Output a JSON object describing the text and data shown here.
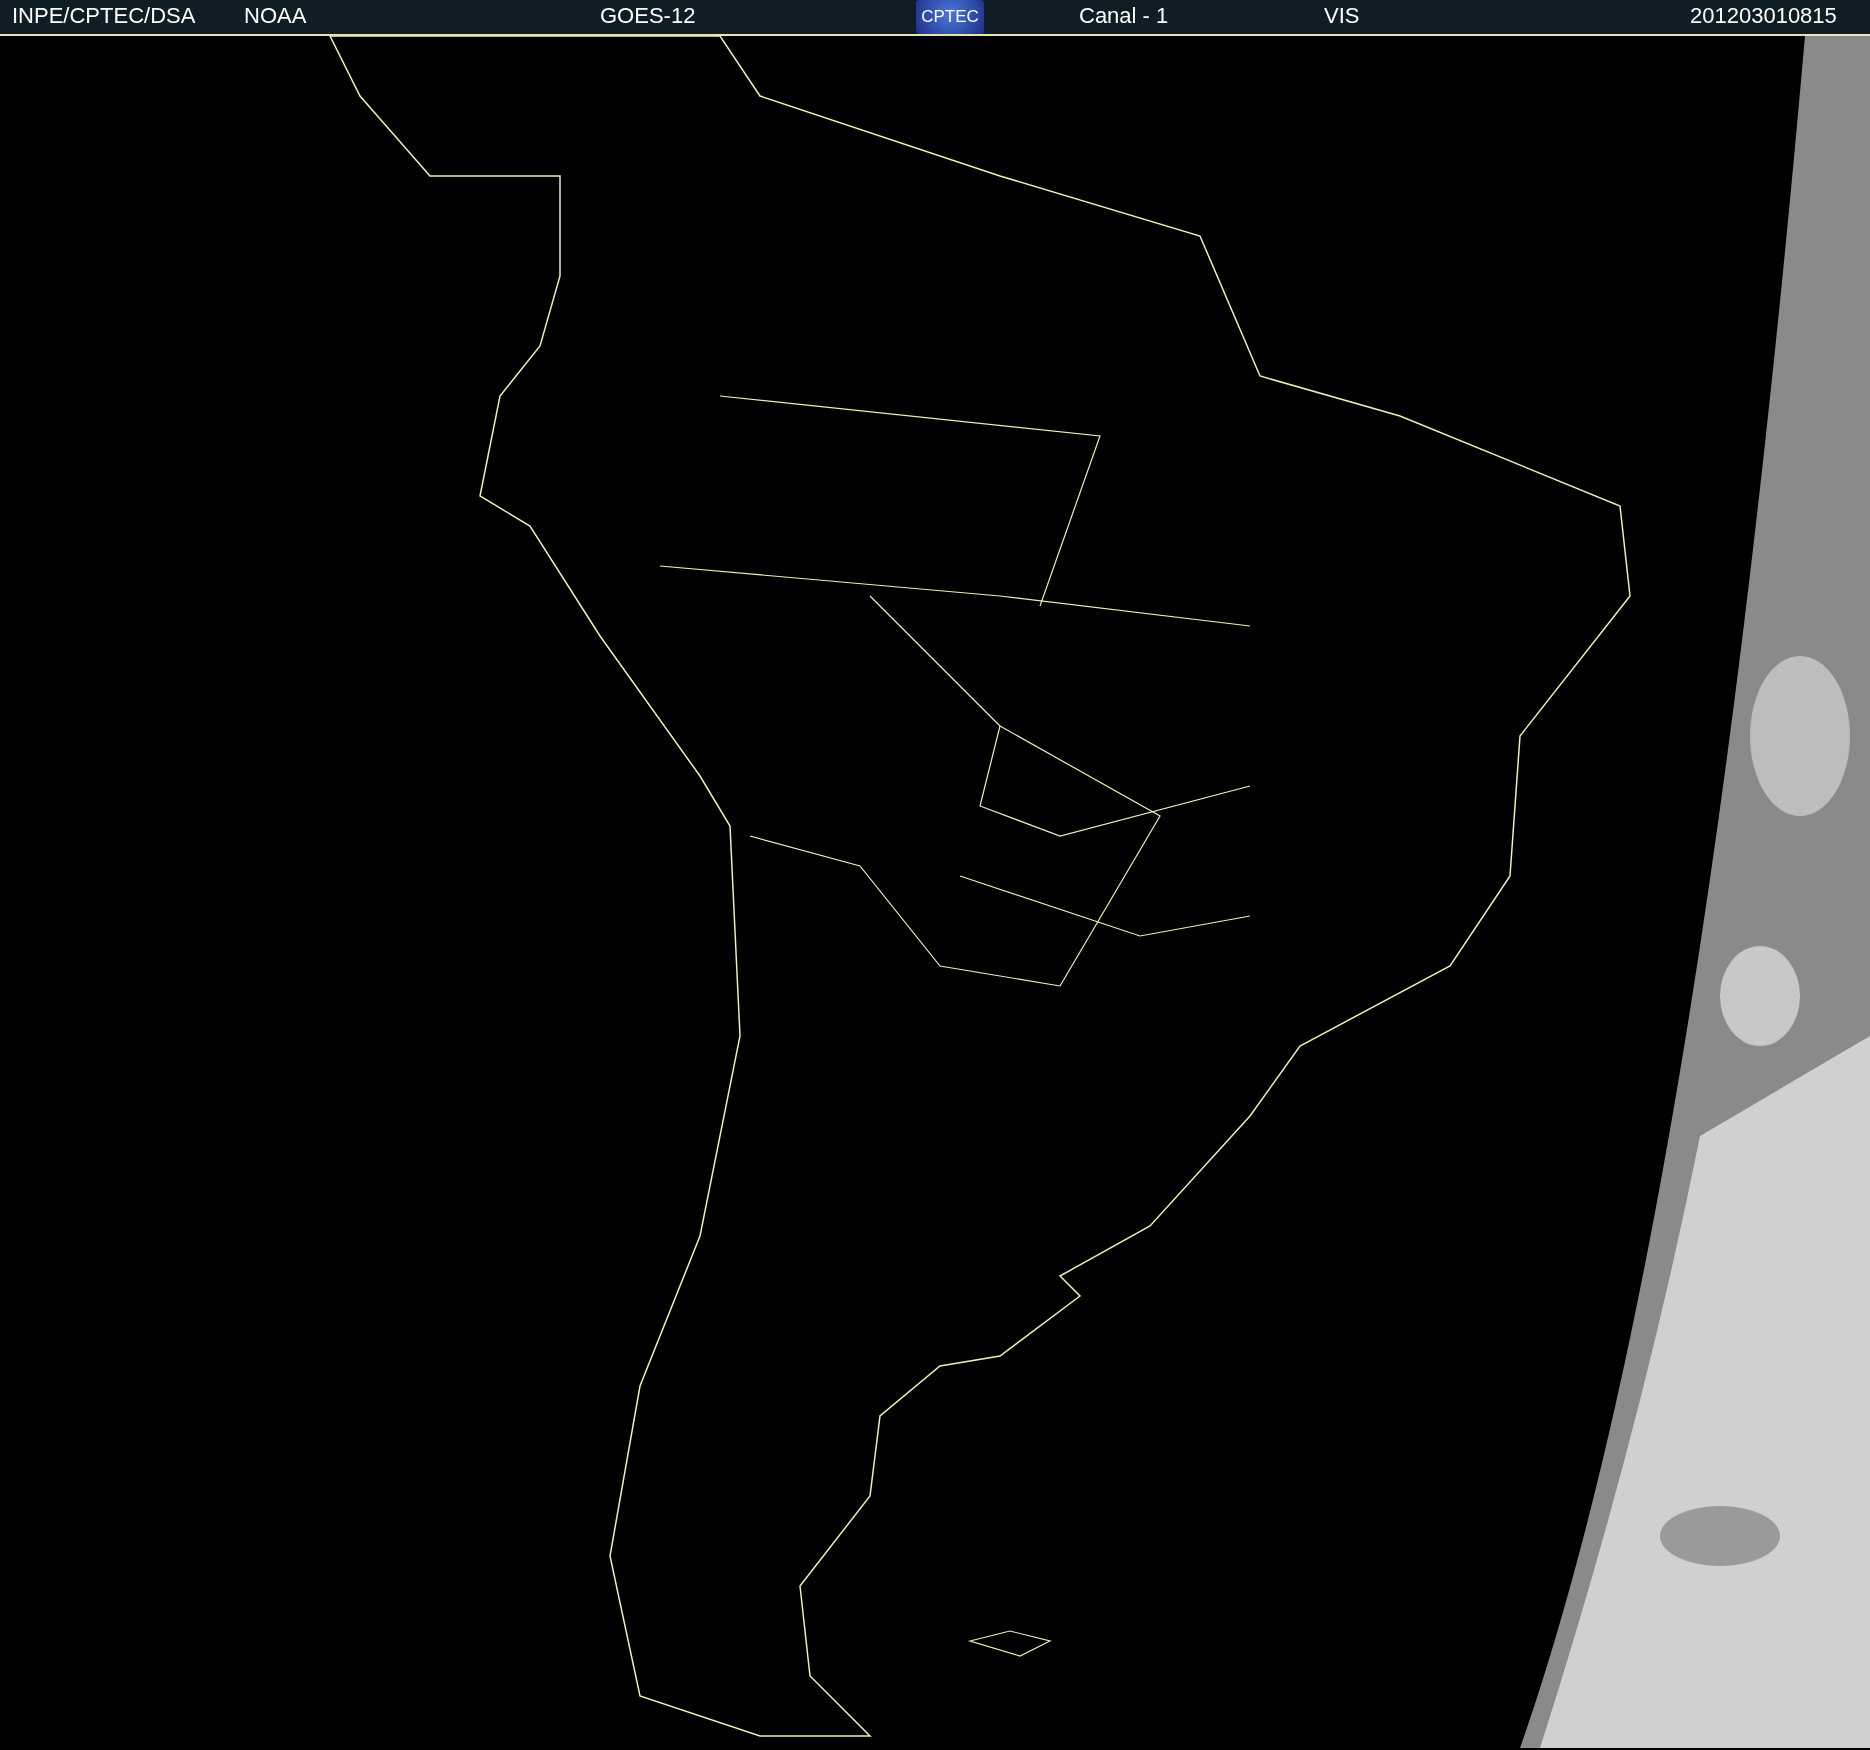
{
  "header": {
    "items": [
      {
        "kind": "text",
        "text": "INPE/CPTEC/DSA"
      },
      {
        "kind": "text",
        "text": "NOAA"
      },
      {
        "kind": "text",
        "text": "GOES-12"
      },
      {
        "kind": "logo",
        "text": "CPTEC"
      },
      {
        "kind": "text",
        "text": "Canal - 1"
      },
      {
        "kind": "text",
        "text": "VIS"
      },
      {
        "kind": "text",
        "text": "201203010815"
      }
    ]
  }
}
